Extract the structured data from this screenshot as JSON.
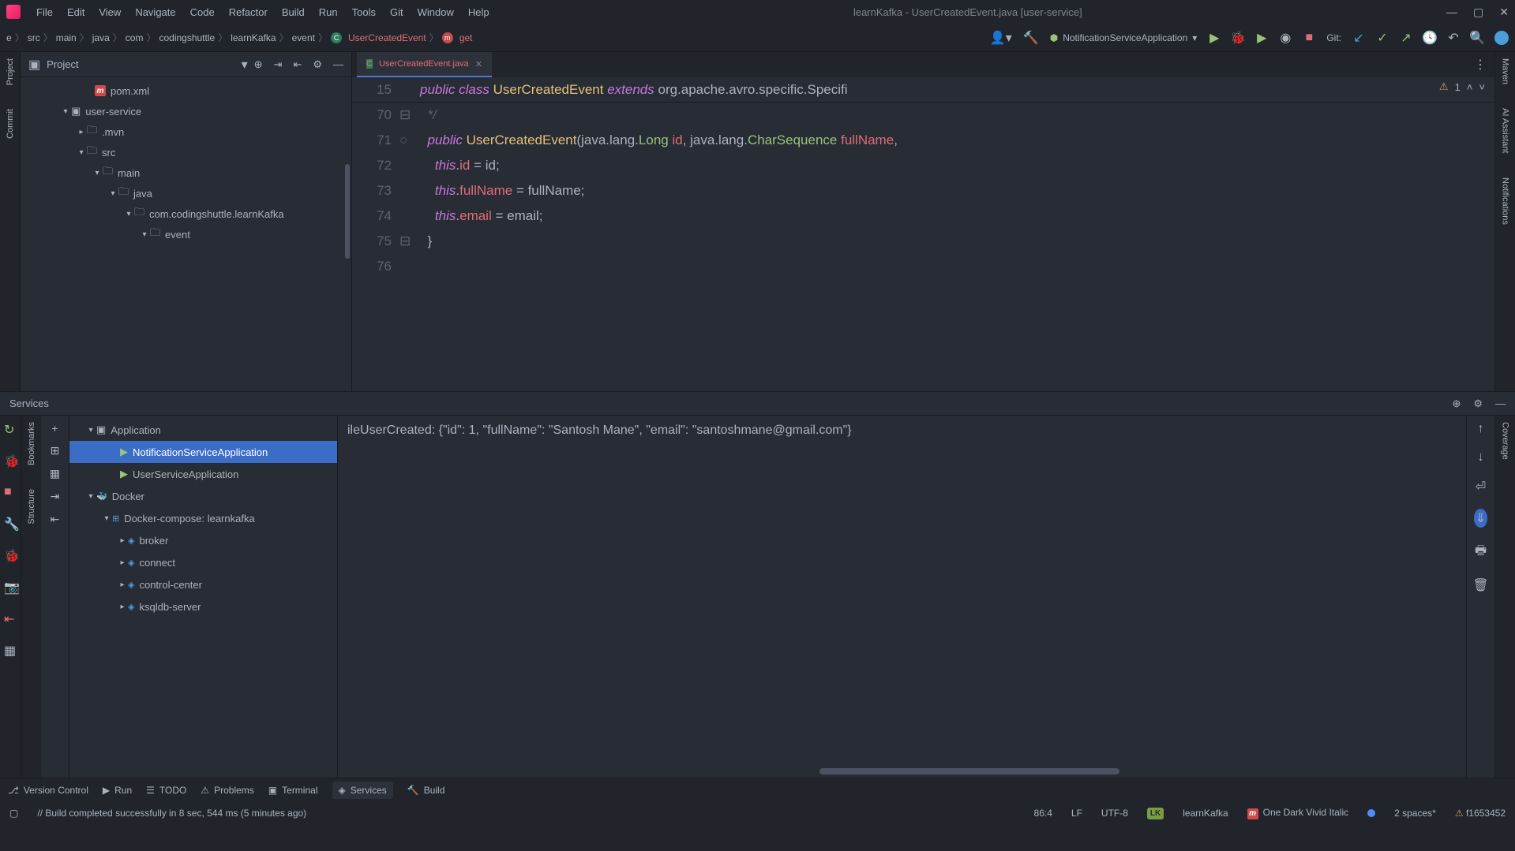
{
  "window": {
    "title": "learnKafka - UserCreatedEvent.java [user-service]"
  },
  "menu": [
    "File",
    "Edit",
    "View",
    "Navigate",
    "Code",
    "Refactor",
    "Build",
    "Run",
    "Tools",
    "Git",
    "Window",
    "Help"
  ],
  "breadcrumb": {
    "items": [
      "e",
      "src",
      "main",
      "java",
      "com",
      "codingshuttle",
      "learnKafka",
      "event"
    ],
    "class": "UserCreatedEvent",
    "method": "get"
  },
  "runConfig": "NotificationServiceApplication",
  "gitLabel": "Git:",
  "projectPanel": {
    "title": "Project",
    "tree": [
      {
        "indent": 80,
        "arrow": "",
        "type": "pom",
        "label": "pom.xml"
      },
      {
        "indent": 50,
        "arrow": "▾",
        "type": "module",
        "label": "user-service"
      },
      {
        "indent": 70,
        "arrow": "▸",
        "type": "folder",
        "label": ".mvn"
      },
      {
        "indent": 70,
        "arrow": "▾",
        "type": "folder",
        "label": "src"
      },
      {
        "indent": 90,
        "arrow": "▾",
        "type": "folder",
        "label": "main"
      },
      {
        "indent": 110,
        "arrow": "▾",
        "type": "folder",
        "label": "java"
      },
      {
        "indent": 130,
        "arrow": "▾",
        "type": "package",
        "label": "com.codingshuttle.learnKafka"
      },
      {
        "indent": 150,
        "arrow": "▾",
        "type": "package",
        "label": "event"
      }
    ]
  },
  "editor": {
    "tab": "UserCreatedEvent.java",
    "warningCount": "1",
    "sticky": {
      "line": "15",
      "code": {
        "kw1": "public",
        "kw2": "class",
        "cls": "UserCreatedEvent",
        "kw3": "extends",
        "rest": "org.apache.avro.specific.Specifi"
      }
    },
    "lines": [
      {
        "num": "70",
        "fold": "⊟",
        "html": "  <span class='cmt'>*/</span>"
      },
      {
        "num": "71",
        "fold": "○",
        "html": "  <span class='kw'>public</span> <span class='cls'>UserCreatedEvent</span><span class='pln'>(</span><span class='pln'>java.lang.</span><span class='typ'>Long</span> <span class='id'>id</span><span class='pln'>, java.lang.</span><span class='typ'>CharSequence</span> <span class='id'>fullName</span><span class='pln'>,</span>"
      },
      {
        "num": "72",
        "fold": "",
        "html": "    <span class='th'>this</span><span class='pln'>.</span><span class='id'>id</span> <span class='pln'>= id;</span>"
      },
      {
        "num": "73",
        "fold": "",
        "html": "    <span class='th'>this</span><span class='pln'>.</span><span class='id'>fullName</span> <span class='pln'>= fullName;</span>"
      },
      {
        "num": "74",
        "fold": "",
        "html": "    <span class='th'>this</span><span class='pln'>.</span><span class='id'>email</span> <span class='pln'>= email;</span>"
      },
      {
        "num": "75",
        "fold": "⊟",
        "html": "  <span class='pln'>}</span>"
      },
      {
        "num": "76",
        "fold": "",
        "html": ""
      }
    ]
  },
  "services": {
    "title": "Services",
    "consoleLine": "ileUserCreated: {\"id\": 1, \"fullName\": \"Santosh Mane\", \"email\": \"santoshmane@gmail.com\"}",
    "tree": [
      {
        "indent": 10,
        "arrow": "▾",
        "icon": "app",
        "label": "Application"
      },
      {
        "indent": 40,
        "arrow": "",
        "icon": "run",
        "label": "NotificationServiceApplication",
        "selected": true
      },
      {
        "indent": 40,
        "arrow": "",
        "icon": "run",
        "label": "UserServiceApplication"
      },
      {
        "indent": 10,
        "arrow": "▾",
        "icon": "docker",
        "label": "Docker"
      },
      {
        "indent": 30,
        "arrow": "▾",
        "icon": "compose",
        "label": "Docker-compose: learnkafka"
      },
      {
        "indent": 50,
        "arrow": "▸",
        "icon": "svc",
        "label": "broker"
      },
      {
        "indent": 50,
        "arrow": "▸",
        "icon": "svc",
        "label": "connect"
      },
      {
        "indent": 50,
        "arrow": "▸",
        "icon": "svc",
        "label": "control-center"
      },
      {
        "indent": 50,
        "arrow": "▸",
        "icon": "svc",
        "label": "ksqldb-server"
      }
    ]
  },
  "bottomBar": {
    "vcs": "Version Control",
    "run": "Run",
    "todo": "TODO",
    "problems": "Problems",
    "terminal": "Terminal",
    "services": "Services",
    "build": "Build"
  },
  "statusBar": {
    "msg": "// Build completed successfully in 8 sec, 544 ms (5 minutes ago)",
    "pos": "86:4",
    "eol": "LF",
    "enc": "UTF-8",
    "branch": "learnKafka",
    "theme": "One Dark Vivid Italic",
    "indent": "2 spaces*",
    "revision": "f1653452"
  },
  "leftStripe": [
    "Project",
    "Commit"
  ],
  "leftStripe2": [
    "Bookmarks",
    "Structure"
  ],
  "rightStripe": [
    "Maven",
    "AI Assistant",
    "Notifications"
  ],
  "rightStripe2": [
    "Coverage"
  ]
}
